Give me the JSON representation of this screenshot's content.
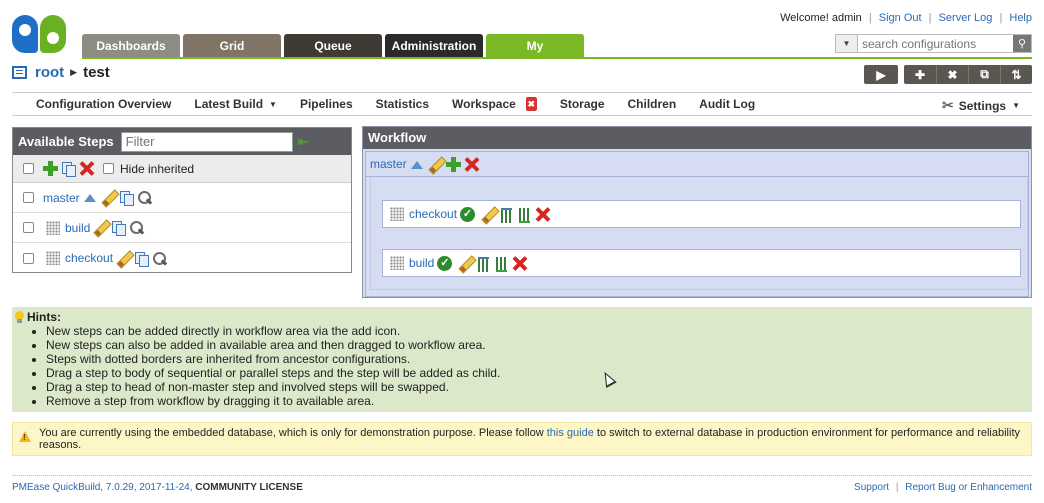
{
  "header": {
    "welcome": "Welcome! admin",
    "links": [
      "Sign Out",
      "Server Log",
      "Help"
    ],
    "search_placeholder": "search configurations"
  },
  "tabs": [
    "Dashboards",
    "Grid",
    "Queue",
    "Administration",
    "My"
  ],
  "breadcrumb": {
    "root": "root",
    "current": "test"
  },
  "subnav": [
    "Configuration Overview",
    "Latest Build",
    "Pipelines",
    "Statistics",
    "Workspace",
    "Storage",
    "Children",
    "Audit Log"
  ],
  "settings_label": "Settings",
  "available_steps": {
    "title": "Available Steps",
    "filter_placeholder": "Filter",
    "hide_inherited": "Hide inherited",
    "items": [
      "master",
      "build",
      "checkout"
    ]
  },
  "workflow": {
    "title": "Workflow",
    "master": "master",
    "steps": [
      "checkout",
      "build"
    ]
  },
  "hints": {
    "title": "Hints:",
    "items": [
      "New steps can be added directly in workflow area via the add icon.",
      "New steps can also be added in available area and then dragged to workflow area.",
      "Steps with dotted borders are inherited from ancestor configurations.",
      "Drag a step to body of sequential or parallel steps and the step will be added as child.",
      "Drag a step to head of non-master step and involved steps will be swapped.",
      "Remove a step from workflow by dragging it to available area."
    ]
  },
  "warning": {
    "before": "You are currently using the embedded database, which is only for demonstration purpose. Please follow ",
    "link": "this guide",
    "after": " to switch to external database in production environment for performance and reliability reasons."
  },
  "footer": {
    "version": "PMEase QuickBuild, 7.0.29, 2017-11-24, ",
    "license": "COMMUNITY LICENSE",
    "support": "Support",
    "report": "Report Bug or Enhancement"
  }
}
